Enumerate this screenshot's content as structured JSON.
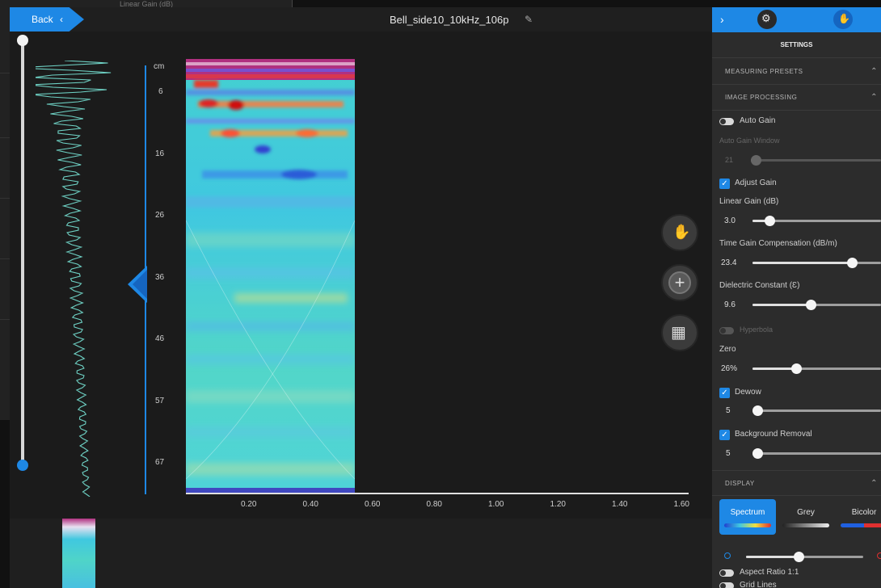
{
  "background_window": {
    "faint_label": "Linear Gain (dB)"
  },
  "header": {
    "back_label": "Back",
    "file_name": "Bell_side10_10kHz_106p"
  },
  "radargram": {
    "depth_unit": "cm",
    "y_ticks": [
      "6",
      "16",
      "26",
      "36",
      "46",
      "57",
      "67"
    ],
    "x_ticks": [
      "0.20",
      "0.40",
      "0.60",
      "0.80",
      "1.00",
      "1.20",
      "1.40",
      "1.60"
    ]
  },
  "settings": {
    "title": "SETTINGS",
    "sections": {
      "measuring_presets": "MEASURING PRESETS",
      "image_processing": "IMAGE PROCESSING",
      "display": "DISPLAY"
    },
    "auto_gain": {
      "label": "Auto Gain",
      "on": false
    },
    "auto_gain_window": {
      "label": "Auto Gain Window",
      "value": "21",
      "level": 0.0
    },
    "adjust_gain": {
      "label": "Adjust Gain",
      "checked": true
    },
    "linear_gain": {
      "label": "Linear Gain (dB)",
      "value": "3.0",
      "level": 0.1
    },
    "tgc": {
      "label": "Time Gain Compensation (dB/m)",
      "value": "23.4",
      "level": 0.8
    },
    "dielectric": {
      "label": "Dielectric Constant (Ɛ)",
      "value": "9.6",
      "level": 0.45
    },
    "hyperbola": {
      "label": "Hyperbola",
      "on": false
    },
    "zero": {
      "label": "Zero",
      "value": "26%",
      "level": 0.33
    },
    "dewow": {
      "label": "Dewow",
      "checked": true,
      "value": "5",
      "level": 0.0
    },
    "background_removal": {
      "label": "Background Removal",
      "checked": true,
      "value": "5",
      "level": 0.0
    },
    "color_modes": [
      "Spectrum",
      "Grey",
      "Bicolor"
    ],
    "active_color_mode": "Spectrum",
    "contrast_level": 0.45,
    "aspect_ratio": {
      "label": "Aspect Ratio 1:1",
      "on": false
    },
    "grid_lines": {
      "label": "Grid Lines",
      "on": false
    }
  },
  "colors": {
    "accent": "#1e88e5",
    "panel": "#2c2c2c",
    "trace": "#6fd3c6"
  }
}
